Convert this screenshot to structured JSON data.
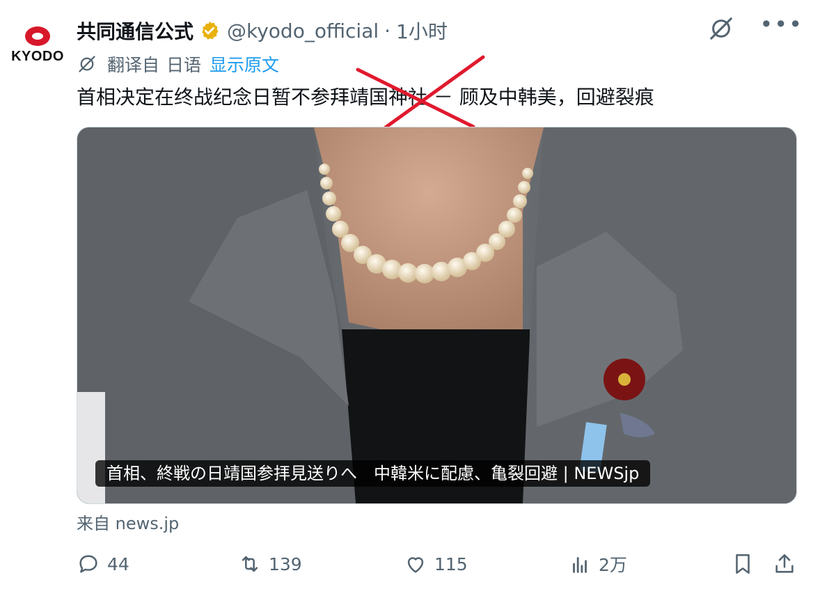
{
  "post": {
    "author_name": "共同通信公式",
    "author_handle": "@kyodo_official",
    "separator": "·",
    "time_ago": "1小时",
    "avatar_text": "KYODO",
    "more_icon": "more-icon",
    "translation": {
      "translated_from": "翻译自",
      "language": "日语",
      "show_original": "显示原文"
    },
    "text": "首相决定在终战纪念日暂不参拜靖国神社 － 顾及中韩美，回避裂痕",
    "media": {
      "caption": "首相、終戦の日靖国参拝見送りへ　中韓米に配慮、亀裂回避 | NEWSjp"
    },
    "source": "来自 news.jp"
  },
  "actions": {
    "reply_count": "44",
    "retweet_count": "139",
    "like_count": "115",
    "views_count": "2万"
  },
  "colors": {
    "text_primary": "#0f1419",
    "text_secondary": "#536471",
    "link": "#1d9bf0",
    "verified": "#e8b10e",
    "brand_red": "#d7182a",
    "overlay_x": "#e0192e"
  }
}
